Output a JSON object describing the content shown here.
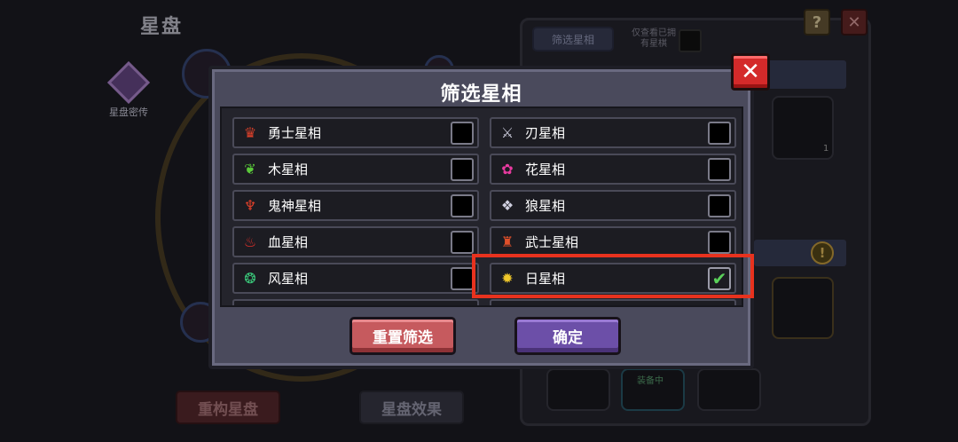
{
  "background": {
    "title": "星盘",
    "left_icon_label": "星盘密传",
    "rebuild_button": "重构星盘",
    "effect_button": "星盘效果",
    "panel_tab": "筛选星相",
    "owned_only_label": "仅查看已拥有星棋",
    "help_label": "?",
    "close_label": "✕",
    "slot_count": "1",
    "equipped_label": "装备中",
    "warn_label": "!"
  },
  "dialog": {
    "title": "筛选星相",
    "close_label": "✕",
    "options": [
      {
        "label": "勇士星相",
        "icon": "warrior-icon",
        "glyph": "♛",
        "color": "#d8402a",
        "checked": false
      },
      {
        "label": "刃星相",
        "icon": "blade-icon",
        "glyph": "⚔",
        "color": "#c8c8d8",
        "checked": false
      },
      {
        "label": "木星相",
        "icon": "wood-leaf-icon",
        "glyph": "❦",
        "color": "#5ac83a",
        "checked": false
      },
      {
        "label": "花星相",
        "icon": "flower-icon",
        "glyph": "✿",
        "color": "#e83aa0",
        "checked": false
      },
      {
        "label": "鬼神星相",
        "icon": "demon-icon",
        "glyph": "♆",
        "color": "#e0402a",
        "checked": false
      },
      {
        "label": "狼星相",
        "icon": "wolf-icon",
        "glyph": "❖",
        "color": "#d0d0e0",
        "checked": false
      },
      {
        "label": "血星相",
        "icon": "blood-drop-icon",
        "glyph": "♨",
        "color": "#e0302a",
        "checked": false
      },
      {
        "label": "武士星相",
        "icon": "samurai-icon",
        "glyph": "♜",
        "color": "#e0502a",
        "checked": false
      },
      {
        "label": "风星相",
        "icon": "wind-icon",
        "glyph": "❂",
        "color": "#3ac87a",
        "checked": false
      },
      {
        "label": "日星相",
        "icon": "sun-icon",
        "glyph": "✹",
        "color": "#f0c82a",
        "checked": true
      }
    ],
    "reset_button": "重置筛选",
    "confirm_button": "确定"
  },
  "check_mark": "✔",
  "colors": {
    "highlight": "#e8321e",
    "reset": "#c65a5e",
    "confirm": "#6c4fa8",
    "close": "#d42a2a",
    "check": "#5ad05a"
  }
}
